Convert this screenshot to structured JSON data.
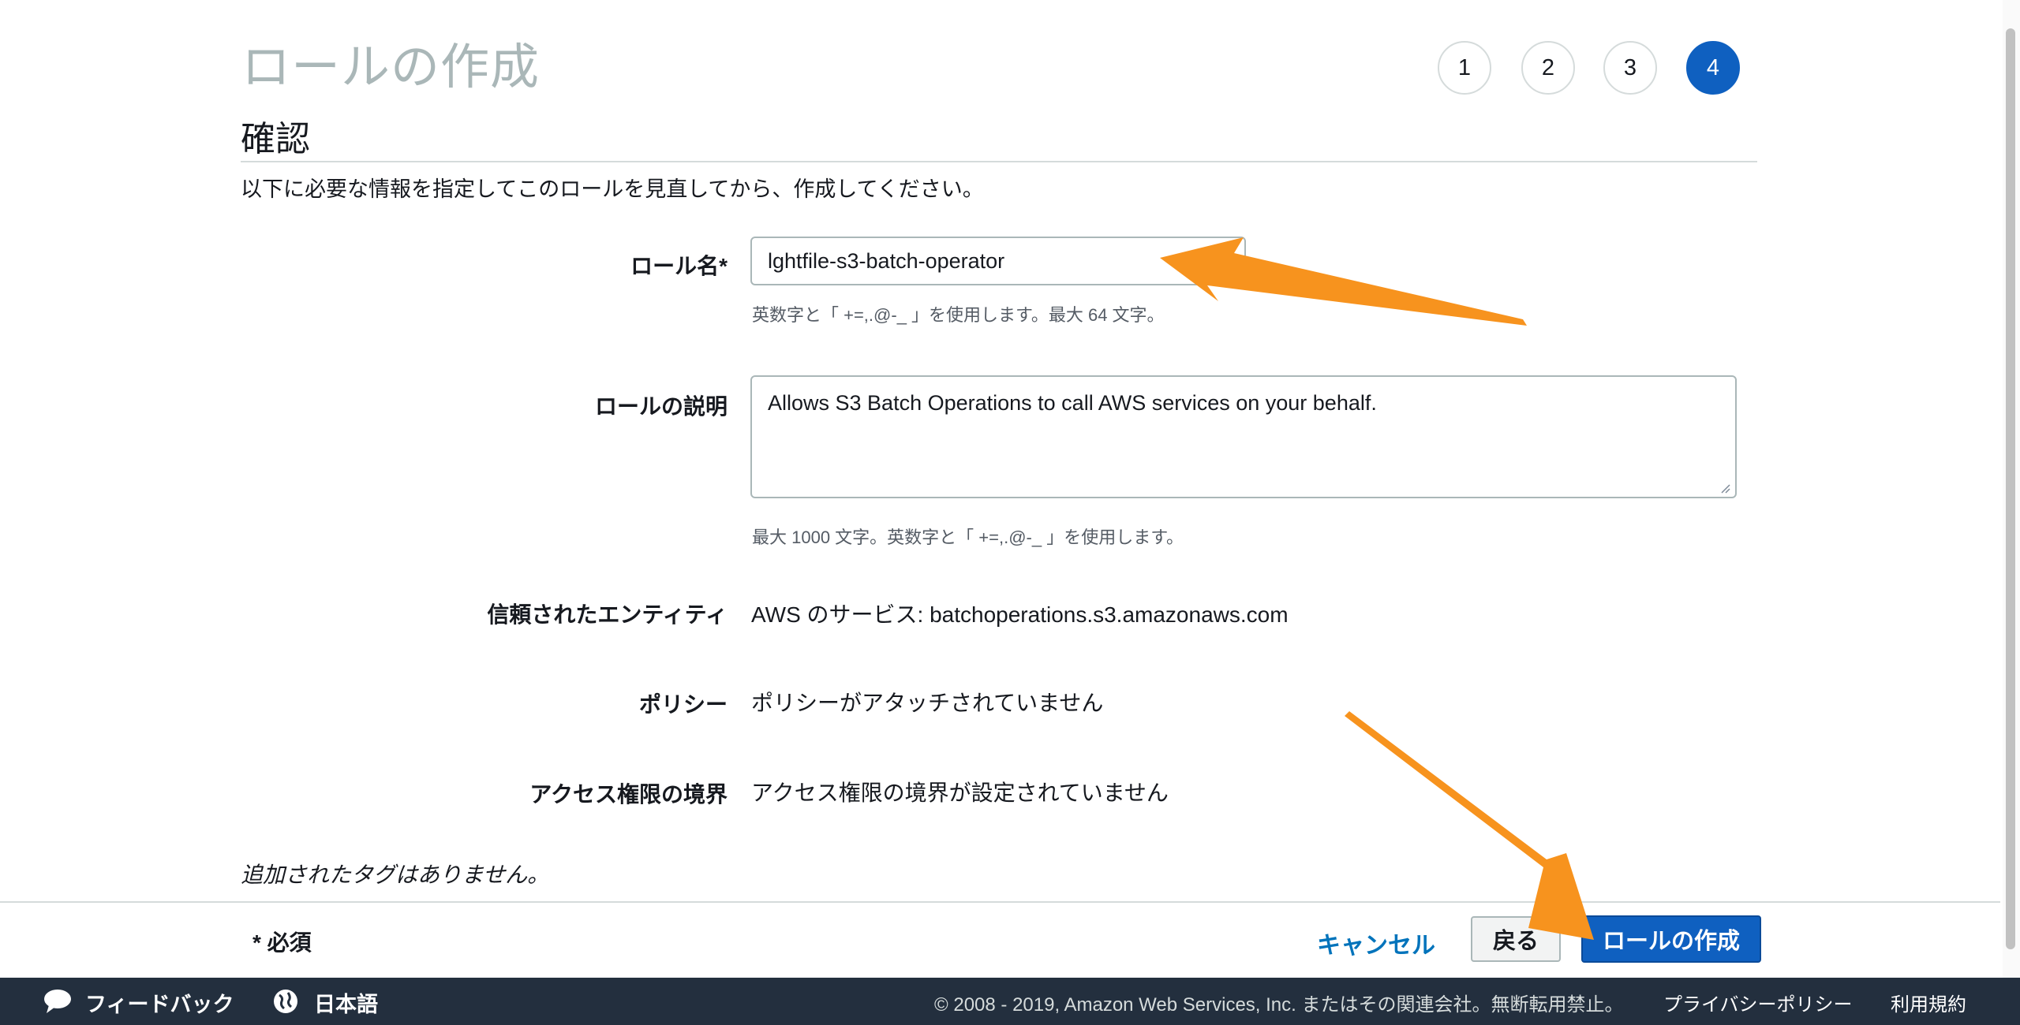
{
  "header": {
    "title": "ロールの作成",
    "steps": [
      "1",
      "2",
      "3",
      "4"
    ],
    "active_step": "4"
  },
  "section": {
    "title": "確認",
    "intro": "以下に必要な情報を指定してこのロールを見直してから、作成してください。"
  },
  "form": {
    "role_name_label": "ロール名*",
    "role_name_value": "lghtfile-s3-batch-operator",
    "role_name_hint": "英数字と「 +=,.@-_ 」を使用します。最大 64 文字。",
    "description_label": "ロールの説明",
    "description_value": "Allows S3 Batch Operations to call AWS services on your behalf.",
    "description_hint": "最大 1000 文字。英数字と「 +=,.@-_ 」を使用します。",
    "trusted_label": "信頼されたエンティティ",
    "trusted_value": "AWS のサービス: batchoperations.s3.amazonaws.com",
    "policy_label": "ポリシー",
    "policy_value": "ポリシーがアタッチされていません",
    "boundary_label": "アクセス権限の境界",
    "boundary_value": "アクセス権限の境界が設定されていません",
    "no_tags": "追加されたタグはありません。"
  },
  "footer": {
    "required": "* 必須",
    "cancel": "キャンセル",
    "back": "戻る",
    "create": "ロールの作成"
  },
  "bottombar": {
    "feedback": "フィードバック",
    "language": "日本語",
    "copyright": "© 2008 - 2019, Amazon Web Services, Inc. またはその関連会社。無断転用禁止。",
    "privacy": "プライバシーポリシー",
    "terms": "利用規約"
  },
  "colors": {
    "primary": "#0f60c0",
    "link": "#0073bb",
    "annotation_arrow": "#f7931e",
    "bottombar_bg": "#232f3e"
  },
  "icons": [
    "chat-bubble-icon",
    "globe-icon",
    "resize-handle-icon",
    "arrow-annotation"
  ]
}
